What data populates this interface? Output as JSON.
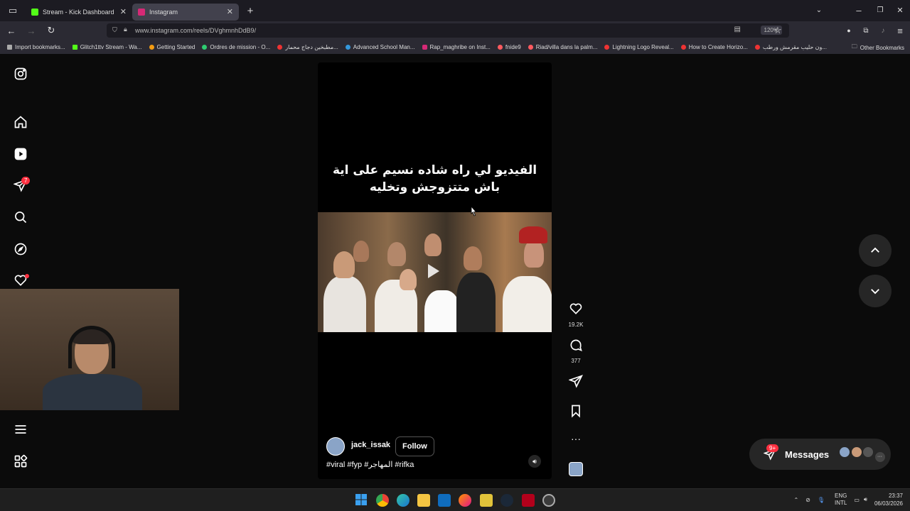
{
  "browser": {
    "tabs": [
      {
        "title": "Stream - Kick Dashboard",
        "active": false
      },
      {
        "title": "Instagram",
        "active": true
      }
    ],
    "url": "www.instagram.com/reels/DVghmnhDdB9/",
    "zoom": "120%",
    "bookmarks": [
      "Import bookmarks...",
      "Glitch1ttv Stream - Wa...",
      "Getting Started",
      "Ordres de mission - O...",
      "مطبخين دجاج محمار...",
      "Advanced School Man...",
      "Rap_maghribe on Inst...",
      "fnide9",
      "Riad/villa dans la palm...",
      "Lightning Logo Reveal...",
      "How to Create Horizo...",
      "ون حليب مقرمش ورطب..."
    ],
    "other_bookmarks": "Other Bookmarks"
  },
  "rail": {
    "notifications_badge": "7"
  },
  "reel": {
    "caption_line1": "الفيديو لي راه شاده نسيم على اية",
    "caption_line2": "باش متتزوجش وتخليه",
    "author": "jack_issak",
    "follow_label": "Follow",
    "hashtags": "#viral #fyp #المهاجر #rifka",
    "likes": "19.2K",
    "comments": "377"
  },
  "messages": {
    "label": "Messages",
    "badge": "9+"
  },
  "taskbar": {
    "lang_line1": "ENG",
    "lang_line2": "INTL",
    "time": "23:37",
    "date": "06/03/2026"
  }
}
